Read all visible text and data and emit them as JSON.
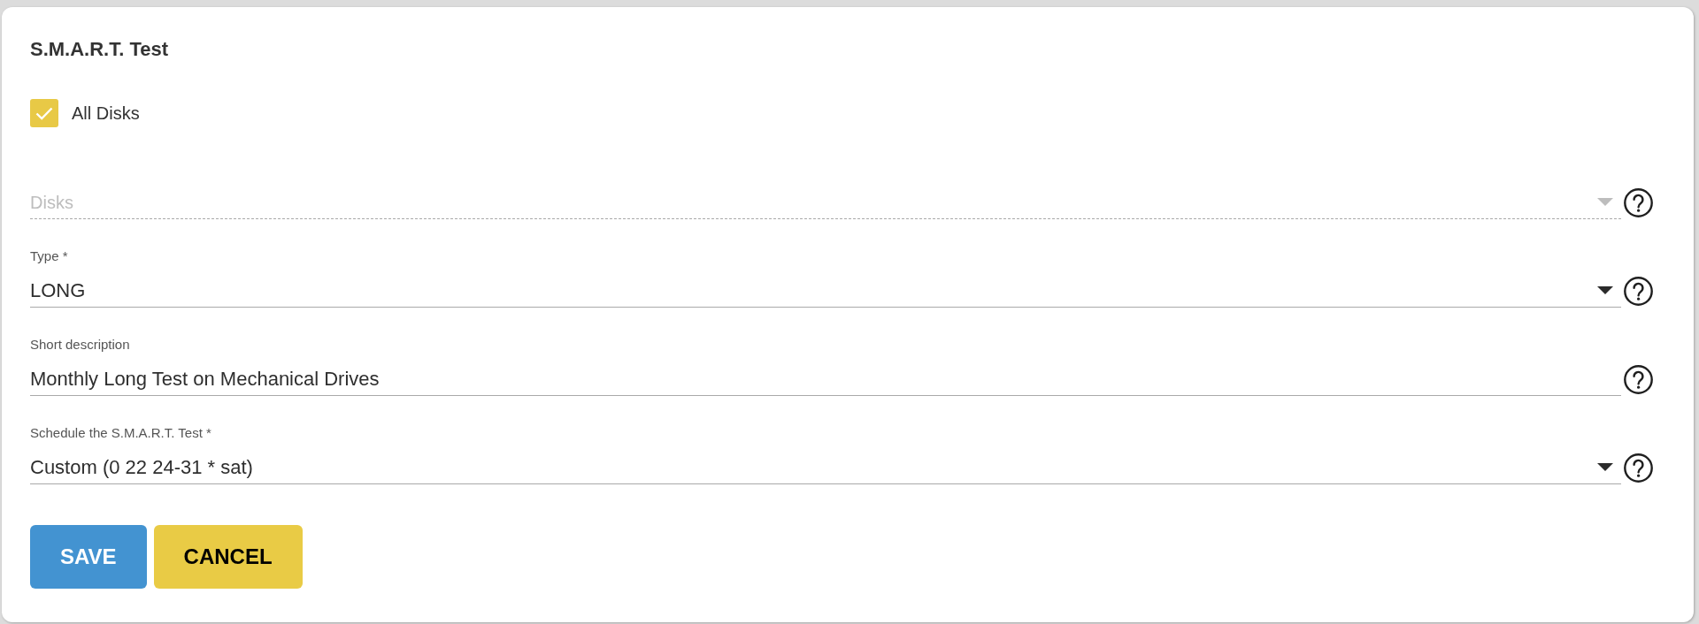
{
  "title": "S.M.A.R.T. Test",
  "all_disks": {
    "label": "All Disks",
    "checked": true
  },
  "fields": [
    {
      "kind": "select",
      "placeholder": "Disks",
      "disabled": true
    },
    {
      "kind": "select",
      "label": "Type *",
      "value": "LONG",
      "disabled": false
    },
    {
      "kind": "text",
      "label": "Short description",
      "value": "Monthly Long Test on Mechanical Drives",
      "disabled": false
    },
    {
      "kind": "select",
      "label": "Schedule the S.M.A.R.T. Test *",
      "value": "Custom (0 22 24-31 * sat)",
      "disabled": false
    }
  ],
  "buttons": [
    {
      "label": "SAVE",
      "kind": "primary"
    },
    {
      "label": "CANCEL",
      "kind": "secondary"
    }
  ]
}
